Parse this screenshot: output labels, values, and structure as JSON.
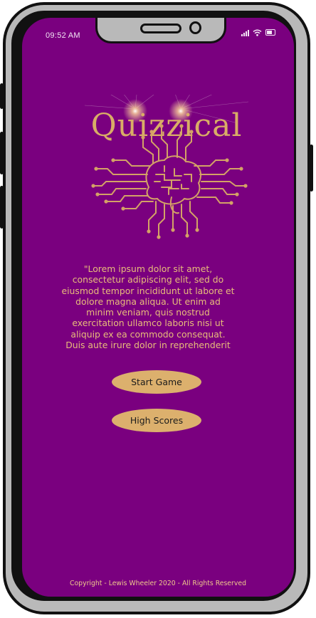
{
  "status_bar": {
    "time": "09:52 AM"
  },
  "logo": {
    "title": "Quizzical",
    "icon": "circuit-brain-icon"
  },
  "intro": {
    "text": "\"Lorem ipsum dolor sit amet, consectetur adipiscing elit, sed do eiusmod tempor incididunt ut labore et dolore magna aliqua. Ut enim ad minim veniam, quis nostrud exercitation ullamco laboris nisi ut aliquip ex ea commodo consequat. Duis aute irure dolor in reprehenderit"
  },
  "buttons": {
    "start": "Start Game",
    "scores": "High Scores"
  },
  "footer": {
    "copyright": "Copyright - Lewis Wheeler 2020 - All Rights Reserved"
  },
  "colors": {
    "background": "#7a007f",
    "accent": "#dcb06d",
    "phone_body": "#b9b9b9"
  }
}
